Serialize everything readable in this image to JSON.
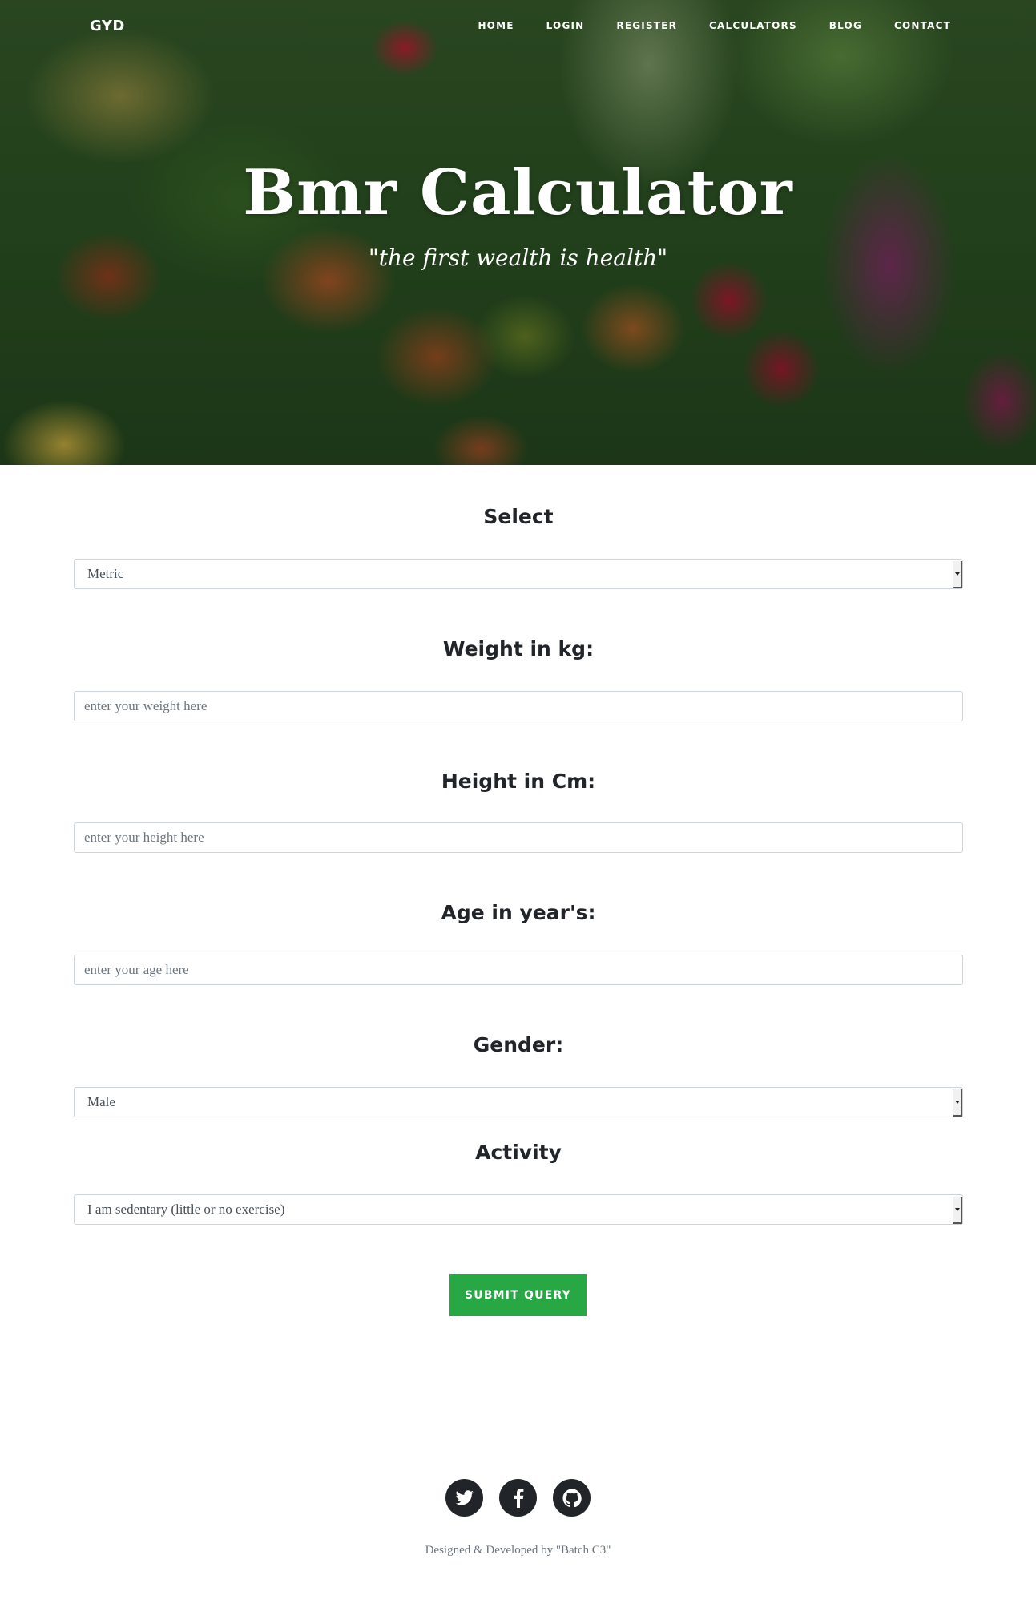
{
  "nav": {
    "brand": "GYD",
    "links": [
      "HOME",
      "LOGIN",
      "REGISTER",
      "CALCULATORS",
      "BLOG",
      "CONTACT"
    ]
  },
  "hero": {
    "title": "Bmr Calculator",
    "subtitle": "\"the first wealth is health\""
  },
  "form": {
    "unit": {
      "label": "Select",
      "value": "Metric"
    },
    "weight": {
      "label": "Weight in kg:",
      "placeholder": "enter your weight here"
    },
    "height": {
      "label": "Height in Cm:",
      "placeholder": "enter your height here"
    },
    "age": {
      "label": "Age in year's:",
      "placeholder": "enter your age here"
    },
    "gender": {
      "label": "Gender:",
      "value": "Male"
    },
    "activity": {
      "label": "Activity",
      "value": "I am sedentary (little or no exercise)"
    },
    "submit": "SUBMIT QUERY"
  },
  "footer": {
    "social_icons": [
      "twitter-icon",
      "facebook-icon",
      "github-icon"
    ],
    "credits": "Designed & Developed by \"Batch C3\""
  },
  "colors": {
    "accent": "#28a745",
    "dark": "#212529"
  }
}
